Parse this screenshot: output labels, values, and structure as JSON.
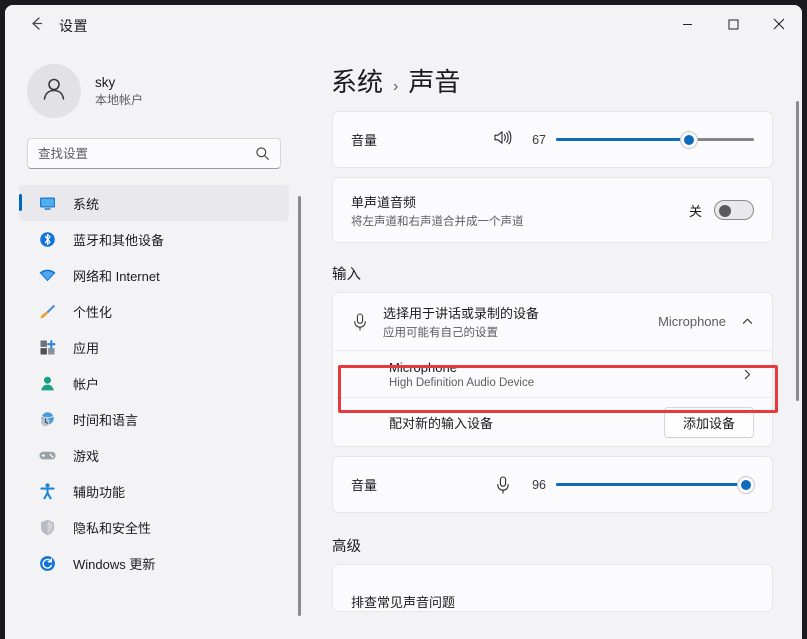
{
  "window": {
    "title": "设置",
    "back_icon": "arrow-left-icon",
    "controls": [
      {
        "name": "minimize",
        "glyph": "—"
      },
      {
        "name": "maximize",
        "glyph": "□"
      },
      {
        "name": "close",
        "glyph": "✕"
      }
    ]
  },
  "profile": {
    "name": "sky",
    "subtitle": "本地帐户",
    "avatar_icon": "person-icon"
  },
  "search": {
    "placeholder": "查找设置",
    "value": "",
    "icon": "search-icon"
  },
  "sidebar": {
    "items": [
      {
        "label": "系统",
        "icon": "monitor-icon",
        "selected": true
      },
      {
        "label": "蓝牙和其他设备",
        "icon": "bluetooth-icon",
        "selected": false
      },
      {
        "label": "网络和 Internet",
        "icon": "wifi-icon",
        "selected": false
      },
      {
        "label": "个性化",
        "icon": "brush-icon",
        "selected": false
      },
      {
        "label": "应用",
        "icon": "apps-icon",
        "selected": false
      },
      {
        "label": "帐户",
        "icon": "account-icon",
        "selected": false
      },
      {
        "label": "时间和语言",
        "icon": "clock-globe-icon",
        "selected": false
      },
      {
        "label": "游戏",
        "icon": "gamepad-icon",
        "selected": false
      },
      {
        "label": "辅助功能",
        "icon": "accessibility-icon",
        "selected": false
      },
      {
        "label": "隐私和安全性",
        "icon": "shield-icon",
        "selected": false
      },
      {
        "label": "Windows 更新",
        "icon": "update-icon",
        "selected": false
      }
    ]
  },
  "breadcrumb": {
    "root": "系统",
    "separator": "›",
    "current": "声音"
  },
  "output": {
    "volume_row": {
      "label": "音量",
      "icon": "speaker-icon",
      "value": "67",
      "percent": 67
    },
    "mono_row": {
      "title": "单声道音频",
      "subtitle": "将左声道和右声道合并成一个声道",
      "toggle_label": "关",
      "toggle_on": false
    }
  },
  "input_section": {
    "heading": "输入",
    "device_picker": {
      "title": "选择用于讲话或录制的设备",
      "subtitle": "应用可能有自己的设置",
      "icon": "microphone-icon",
      "value": "Microphone",
      "chevron": "chevron-up-icon"
    },
    "device_item": {
      "title": "Microphone",
      "subtitle": "High Definition Audio Device",
      "chevron": "chevron-right-icon",
      "highlighted": true,
      "highlight_color": "#e8393c"
    },
    "pair_row": {
      "label": "配对新的输入设备",
      "button_label": "添加设备"
    },
    "volume_row": {
      "label": "音量",
      "icon": "microphone-icon",
      "value": "96",
      "percent": 96
    }
  },
  "advanced_section": {
    "heading": "高级",
    "first_item": "排查常见声音问题"
  },
  "colors": {
    "accent": "#0067c0",
    "slider_fill": "#0f6cbd",
    "highlight": "#e8393c",
    "surface": "#fbfbfd",
    "background": "#f3f3f6"
  }
}
